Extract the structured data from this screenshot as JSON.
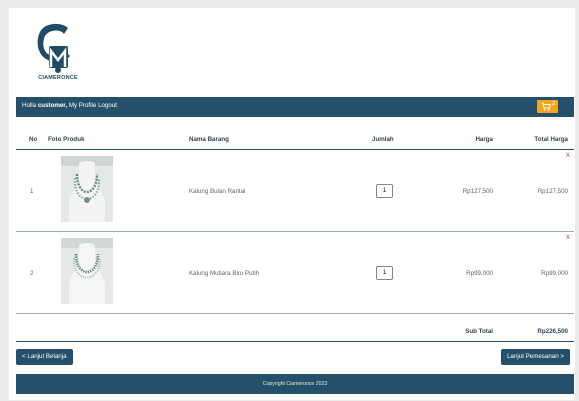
{
  "brand": {
    "logo_text": "CIAMERONCE"
  },
  "navbar": {
    "greeting": "Holla",
    "username": "customer,",
    "my_profile": "My Profile",
    "logout": "Logout",
    "cart_count": "2",
    "accent": "#f3a51d"
  },
  "table": {
    "headers": {
      "no": "No",
      "photo": "Foto Produk",
      "name": "Nama Barang",
      "qty": "Jumlah",
      "price": "Harga",
      "total": "Total Harga"
    },
    "rows": [
      {
        "no": "1",
        "name": "Kalung Bulan Rantai",
        "qty": "1",
        "price": "Rp127,500",
        "total": "Rp127,500",
        "remove": "X"
      },
      {
        "no": "2",
        "name": "Kalung Mutiara Biru Putih",
        "qty": "1",
        "price": "Rp99,000",
        "total": "Rp99,000",
        "remove": "X"
      }
    ],
    "subtotal_label": "Sub Total",
    "subtotal_value": "Rp226,500"
  },
  "actions": {
    "continue_shopping": "< Lanjut Belanja",
    "checkout": "Lanjut Pemesanan >"
  },
  "footer": {
    "copyright": "Copyright Ciameronce 2023"
  },
  "colors": {
    "primary": "#24506b",
    "accent": "#f3a51d",
    "remove": "#c0392b"
  }
}
